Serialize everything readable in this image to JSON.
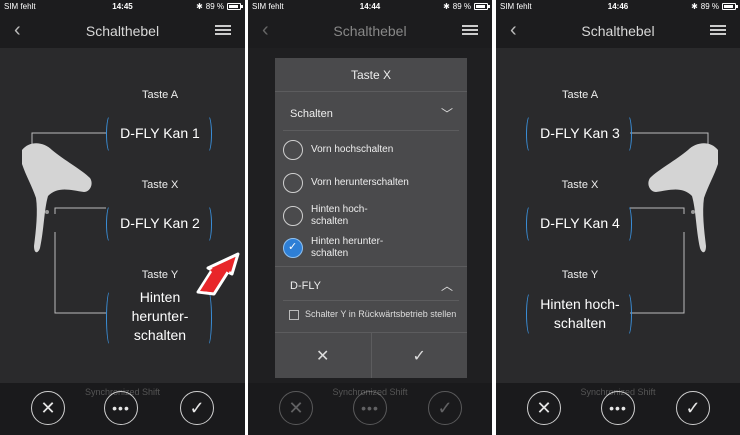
{
  "panels": [
    {
      "status": {
        "carrier": "SIM fehlt",
        "time": "14:45",
        "battery": "89 %"
      },
      "title": "Schalthebel",
      "taste_a": {
        "label": "Taste A",
        "value": "D-FLY Kan 1"
      },
      "taste_x": {
        "label": "Taste X",
        "value": "D-FLY Kan 2"
      },
      "taste_y": {
        "label": "Taste Y",
        "value_l1": "Hinten",
        "value_l2": "herunter-",
        "value_l3": "schalten"
      }
    },
    {
      "status": {
        "carrier": "SIM fehlt",
        "time": "14:44",
        "battery": "89 %"
      },
      "title": "Schalthebel",
      "dialog": {
        "title": "Taste X",
        "section_schalten": "Schalten",
        "options": [
          {
            "l1": "Vorn hochschalten",
            "l2": "",
            "selected": false
          },
          {
            "l1": "Vorn herunterschalten",
            "l2": "",
            "selected": false
          },
          {
            "l1": "Hinten hoch-",
            "l2": "schalten",
            "selected": false
          },
          {
            "l1": "Hinten herunter-",
            "l2": "schalten",
            "selected": true
          }
        ],
        "section_dfly": "D-FLY",
        "checkbox_label": "Schalter Y in Rückwärtsbetrieb stellen"
      },
      "sync_text": "Synchronized Shift"
    },
    {
      "status": {
        "carrier": "SIM fehlt",
        "time": "14:46",
        "battery": "89 %"
      },
      "title": "Schalthebel",
      "taste_a": {
        "label": "Taste A",
        "value": "D-FLY Kan 3"
      },
      "taste_x": {
        "label": "Taste X",
        "value": "D-FLY Kan 4"
      },
      "taste_y": {
        "label": "Taste Y",
        "value_l1": "Hinten hoch-",
        "value_l2": "schalten"
      }
    }
  ],
  "sync_text_left": "Synchronized Shift",
  "sync_text_right": "Synchronized Shift",
  "icons": {
    "back": "chevron-left-icon",
    "menu": "hamburger-icon",
    "cancel": "x-circle-icon",
    "more": "dots-circle-icon",
    "confirm": "check-circle-icon"
  },
  "colors": {
    "accent": "#3a8ed8",
    "arrow": "#e8262a",
    "background": "#2a2a2c"
  }
}
